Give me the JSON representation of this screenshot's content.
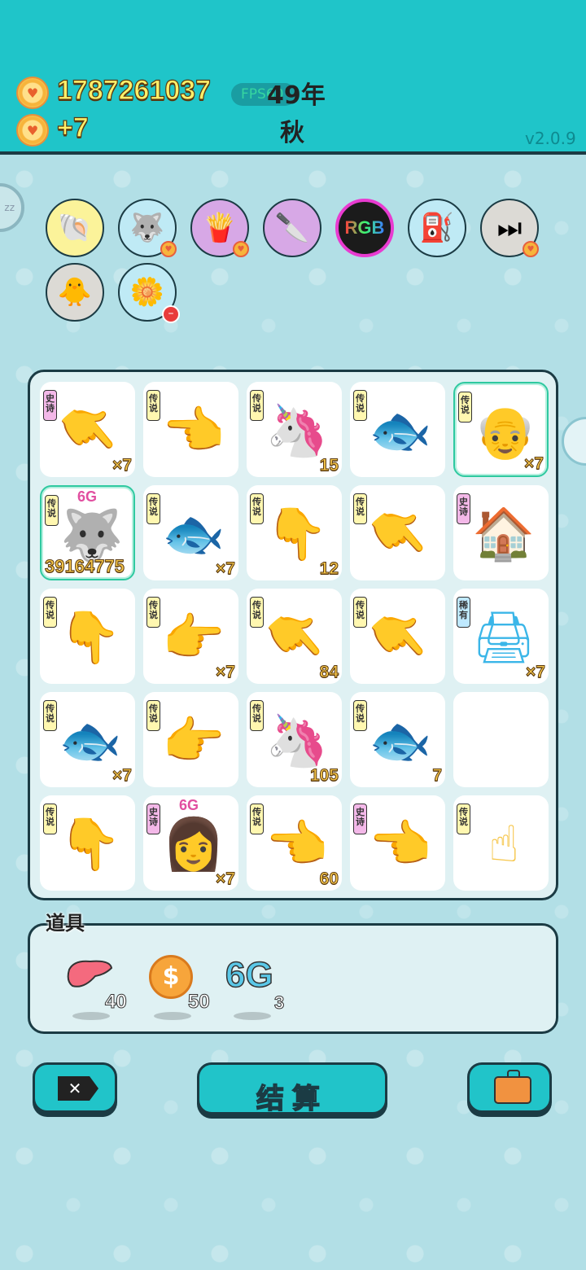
{
  "header": {
    "coins": "1787261037",
    "income": "+7",
    "fps_label": "FPS60",
    "year": "49年",
    "season": "秋",
    "version": "v2.0.9"
  },
  "badges": [
    {
      "name": "shell-icon",
      "bg": "#fbf39a"
    },
    {
      "name": "husky-icon",
      "bg": "#bfeaf5"
    },
    {
      "name": "fries-icon",
      "bg": "#d7a8e6"
    },
    {
      "name": "cleaver-icon",
      "bg": "#d7a8e6"
    },
    {
      "name": "rgb-icon",
      "bg": "#1b1b1b"
    },
    {
      "name": "pump-icon",
      "bg": "#bfeaf5"
    },
    {
      "name": "skip-icon",
      "bg": "#dcdad5"
    },
    {
      "name": "chick-icon",
      "bg": "#dcdad5"
    },
    {
      "name": "flower-icon",
      "bg": "#bfeaf5"
    }
  ],
  "grid": [
    [
      {
        "tag": "史诗",
        "item": "pointing-hand-gray",
        "count": "×7"
      },
      {
        "tag": "传说",
        "item": "pointing-hand-yellow-left",
        "count": ""
      },
      {
        "tag": "传说",
        "item": "unicorn",
        "count": "15"
      },
      {
        "tag": "传说",
        "item": "koi-fish",
        "count": ""
      },
      {
        "tag": "传说",
        "item": "king-face",
        "count": "×7"
      }
    ],
    [
      {
        "tag": "传说",
        "item": "husky-king",
        "count": "39164775",
        "badge": "6G"
      },
      {
        "tag": "传说",
        "item": "koi-fish",
        "count": "×7"
      },
      {
        "tag": "传说",
        "item": "pointing-hand-yellow-down",
        "count": "12"
      },
      {
        "tag": "传说",
        "item": "pointing-hand-yellow-diag",
        "count": ""
      },
      {
        "tag": "史诗",
        "item": "rabbit-house",
        "count": ""
      }
    ],
    [
      {
        "tag": "传说",
        "item": "pointing-hand-yellow-down",
        "count": ""
      },
      {
        "tag": "传说",
        "item": "pointing-hand-yellow-right",
        "count": "×7"
      },
      {
        "tag": "传说",
        "item": "pointing-hand-yellow-diag",
        "count": "84"
      },
      {
        "tag": "传说",
        "item": "pointing-hand-yellow-diag",
        "count": ""
      },
      {
        "tag": "稀有",
        "item": "printer",
        "count": "×7"
      }
    ],
    [
      {
        "tag": "传说",
        "item": "koi-fish",
        "count": "×7"
      },
      {
        "tag": "传说",
        "item": "pointing-hand-yellow-right",
        "count": ""
      },
      {
        "tag": "传说",
        "item": "unicorn",
        "count": "105"
      },
      {
        "tag": "传说",
        "item": "koi-fish",
        "count": "7"
      },
      {
        "tag": "",
        "item": "",
        "count": ""
      }
    ],
    [
      {
        "tag": "传说",
        "item": "pointing-hand-yellow-down",
        "count": ""
      },
      {
        "tag": "史诗",
        "item": "girl-face",
        "count": "×7",
        "badge": "6G"
      },
      {
        "tag": "传说",
        "item": "pointing-hand-yellow-left",
        "count": "60"
      },
      {
        "tag": "史诗",
        "item": "pointing-hand-gray-left",
        "count": ""
      },
      {
        "tag": "传说",
        "item": "pointing-hand-yellow-up",
        "count": ""
      }
    ]
  ],
  "props": {
    "label": "道具",
    "items": [
      {
        "name": "liver-icon",
        "count": "40"
      },
      {
        "name": "dollar-coin-icon",
        "count": "50"
      },
      {
        "name": "6g-icon",
        "label": "6G",
        "count": "3"
      }
    ]
  },
  "buttons": {
    "settle": "结算"
  },
  "colors": {
    "header_bg": "#1fc5c9",
    "panel_bg": "#dff1f3",
    "accent_gold": "#f6c64a",
    "border_dark": "#1b3b44"
  }
}
